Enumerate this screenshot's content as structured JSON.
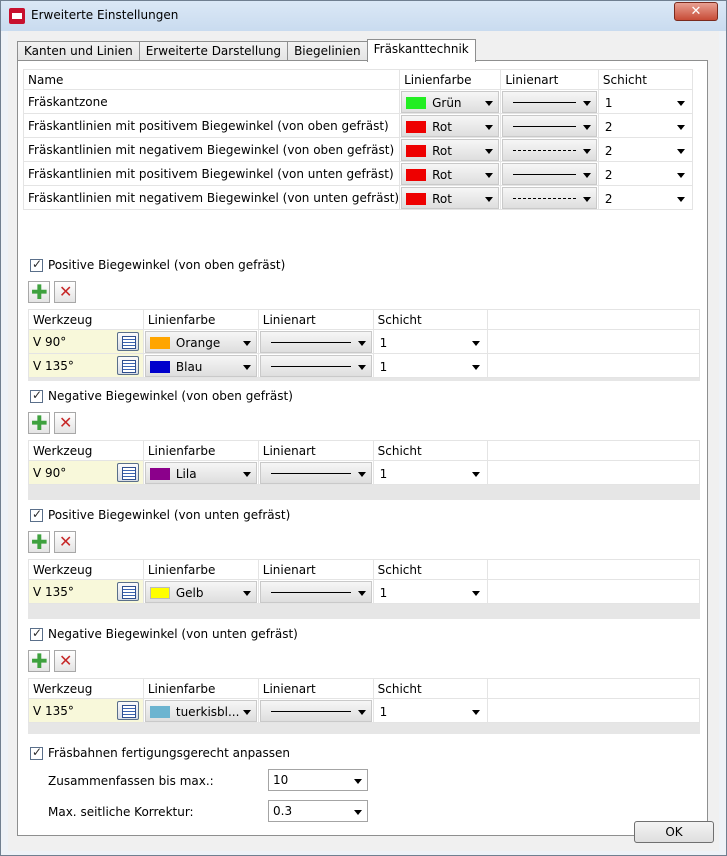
{
  "window": {
    "title": "Erweiterte Einstellungen",
    "close_label": "✕"
  },
  "tabs": [
    {
      "label": "Kanten und Linien"
    },
    {
      "label": "Erweiterte Darstellung"
    },
    {
      "label": "Biegelinien"
    },
    {
      "label": "Fräskanttechnik"
    }
  ],
  "zones": {
    "headers": {
      "name": "Name",
      "color": "Linienfarbe",
      "linetype": "Linienart",
      "layer": "Schicht"
    },
    "rows": [
      {
        "name": "Fräskantzone",
        "color": "Grün",
        "swatch": "#22ee22",
        "linetype": "solid",
        "layer": "1"
      },
      {
        "name": "Fräskantlinien mit positivem Biegewinkel (von oben gefräst)",
        "color": "Rot",
        "swatch": "#ee0000",
        "linetype": "solid",
        "layer": "2"
      },
      {
        "name": "Fräskantlinien mit negativem Biegewinkel (von oben gefräst)",
        "color": "Rot",
        "swatch": "#ee0000",
        "linetype": "dashed",
        "layer": "2"
      },
      {
        "name": "Fräskantlinien mit positivem Biegewinkel (von unten gefräst)",
        "color": "Rot",
        "swatch": "#ee0000",
        "linetype": "solid",
        "layer": "2"
      },
      {
        "name": "Fräskantlinien mit negativem Biegewinkel (von unten gefräst)",
        "color": "Rot",
        "swatch": "#ee0000",
        "linetype": "dashed",
        "layer": "2"
      }
    ]
  },
  "tool_headers": {
    "tool": "Werkzeug",
    "color": "Linienfarbe",
    "linetype": "Linienart",
    "layer": "Schicht"
  },
  "sections": [
    {
      "label": "Positive Biegewinkel (von oben gefräst)",
      "checked": true,
      "rows": [
        {
          "tool": "V 90°",
          "color": "Orange",
          "swatch": "#ffa500",
          "layer": "1"
        },
        {
          "tool": "V 135°",
          "color": "Blau",
          "swatch": "#0000cc",
          "layer": "1"
        }
      ]
    },
    {
      "label": "Negative Biegewinkel (von oben gefräst)",
      "checked": true,
      "rows": [
        {
          "tool": "V 90°",
          "color": "Lila",
          "swatch": "#8b008b",
          "layer": "1"
        }
      ]
    },
    {
      "label": "Positive Biegewinkel (von unten gefräst)",
      "checked": true,
      "rows": [
        {
          "tool": "V 135°",
          "color": "Gelb",
          "swatch": "#ffff00",
          "layer": "1"
        }
      ]
    },
    {
      "label": "Negative Biegewinkel (von unten gefräst)",
      "checked": true,
      "rows": [
        {
          "tool": "V 135°",
          "color": "tuerkisbl...",
          "swatch": "#6cb4d0",
          "layer": "1"
        }
      ]
    }
  ],
  "bottom": {
    "checkbox_label": "Fräsbahnen fertigungsgerecht anpassen",
    "max_label": "Zusammenfassen bis max.:",
    "max_value": "10",
    "korr_label": "Max. seitliche Korrektur:",
    "korr_value": "0.3"
  },
  "ok_label": "OK",
  "icons": {
    "app": "app-logo-icon",
    "add": "plus-icon",
    "remove": "delete-x-icon",
    "tool": "tool-select-icon"
  }
}
